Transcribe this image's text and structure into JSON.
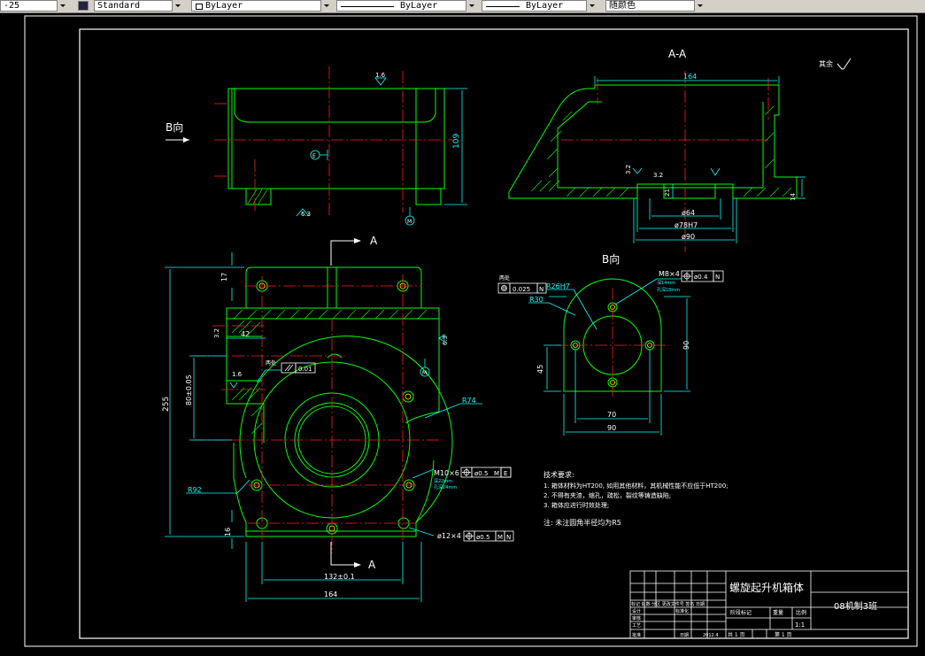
{
  "toolbar": {
    "dimstyle_value": "-25",
    "textstyle_value": "Standard",
    "layer_value": "ByLayer",
    "linetype_value": "ByLayer",
    "lineweight_value": "ByLayer",
    "color_value": "随颜色"
  },
  "drawing": {
    "section_label": "A-A",
    "view_b_top": "B向",
    "view_b_label": "B向",
    "rest_roughness": "其余",
    "section_arrow_label_top": "A",
    "section_arrow_label_bottom": "A",
    "dims": {
      "dim_109": "109",
      "dim_164_top": "164",
      "dim_32_right": "3.2",
      "dim_32_b": "3.2",
      "dim_21": "21",
      "dim_14": "14",
      "dim_phi64": "ø64",
      "dim_phi78h7": "ø78H7",
      "dim_phi90": "ø90",
      "dim_17": "17",
      "dim_42": "42",
      "dim_32_left": "3.2",
      "dim_80": "80±0.05",
      "dim_255": "255",
      "dim_16": "16",
      "dim_132": "132±0.1",
      "dim_164_bottom": "164",
      "dim_r74": "R74",
      "dim_r92": "R92",
      "dim_r30": "R30",
      "dim_r26h7": "R26H7",
      "dim_45": "45",
      "dim_70": "70",
      "dim_90_b": "90",
      "dim_90_v": "90",
      "rough_16_top": "1.6",
      "rough_63_a": "6.3",
      "rough_16_left": "1.6",
      "rough_63_b": "6.3"
    },
    "callouts": {
      "m8": "M8×4",
      "m8_depth1": "深14mm",
      "m8_depth2": "孔深18mm",
      "m8_tol": "ø0.4",
      "m8_ref": "N",
      "m10": "M10×6",
      "m10_depth1": "深22mm",
      "m10_depth2": "孔深24mm",
      "m10_tol": "ø0.5",
      "m10_ref": "M",
      "m10_ref2": "E",
      "phi12": "ø12×4",
      "phi12_tol": "ø0.5",
      "phi12_ref": "M",
      "phi12_ref2": "N",
      "flat_tol": "0.025",
      "flat_ref": "N",
      "flat_label": "两处",
      "par_tol": "0.01",
      "par_label": "两处",
      "datum_e": "E",
      "datum_m": "M",
      "datum_n": "N"
    },
    "notes": {
      "title": "技术要求:",
      "line1": "1. 箱体材料为HT200, 如用其他材料，其机械性能不应低于HT200;",
      "line2": "2. 不得有夹渣，缩孔，疏松，裂纹等铸造缺陷;",
      "line3": "3. 箱体应进行时效处理;",
      "line4": "注: 未注圆角半径均为R5"
    },
    "title_block": {
      "part_name": "螺旋起升机箱体",
      "class_name": "08机制3班",
      "scale": "1:1",
      "header_marks": "标记 处数 分区 更改文件号 签名 日期",
      "stage_label": "阶段标记",
      "weight_label": "重量",
      "scale_label": "比例",
      "design_label": "设计",
      "check_label": "审核",
      "craft_label": "工艺",
      "approve_label": "批准",
      "std_label": "标准化",
      "date_label": "日期",
      "date_value": "2012.4",
      "sheets_total": "共 1 页",
      "sheet_no": "第 1 页"
    }
  },
  "colors": {
    "outline": "#00ff00",
    "centerline": "#ff2020",
    "dimension": "#00ffff",
    "text": "#ffffff",
    "background": "#000000",
    "toolbar": "#d4d0c8"
  }
}
